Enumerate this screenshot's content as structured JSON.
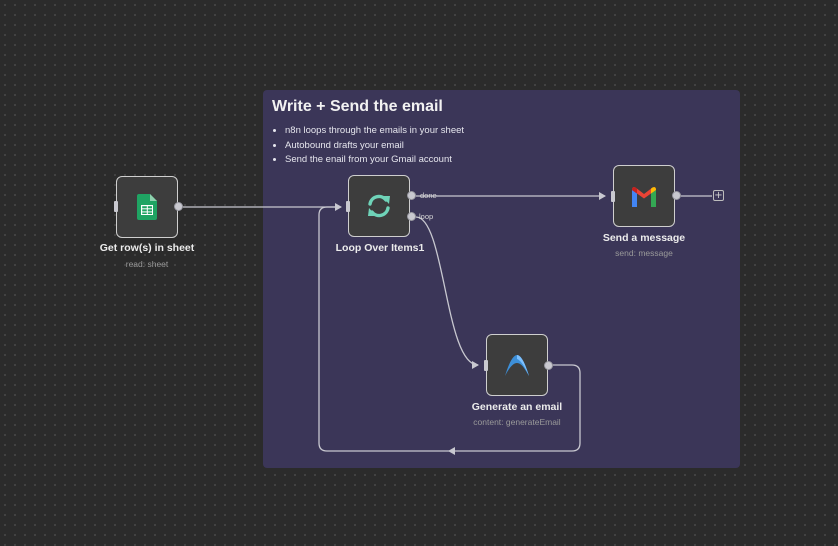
{
  "sticky": {
    "title": "Write + Send the email",
    "bullets": [
      "n8n loops through the emails in your sheet",
      "Autobound drafts your email",
      "Send the enail from your Gmail account"
    ]
  },
  "nodes": {
    "get_rows": {
      "label": "Get row(s) in sheet",
      "subtitle": "read: sheet",
      "icon": "google-sheets-icon"
    },
    "loop": {
      "label": "Loop Over Items1",
      "icon": "loop-arrows-icon",
      "branches": {
        "done": "done",
        "loop": "loop"
      }
    },
    "send": {
      "label": "Send a message",
      "subtitle": "send: message",
      "icon": "gmail-icon"
    },
    "generate": {
      "label": "Generate an email",
      "subtitle": "content: generateEmail",
      "icon": "autobound-icon"
    }
  },
  "add_button": {
    "symbol": "+"
  },
  "colors": {
    "canvas": "#2b2b2b",
    "sticky": "#3b3658",
    "node_bg": "#3d3d3d",
    "edge": "#c8c8d0",
    "sheets_green": "#1fa463",
    "loop_teal": "#6fd3b8",
    "autobound_blue": "#3d8fd8"
  }
}
